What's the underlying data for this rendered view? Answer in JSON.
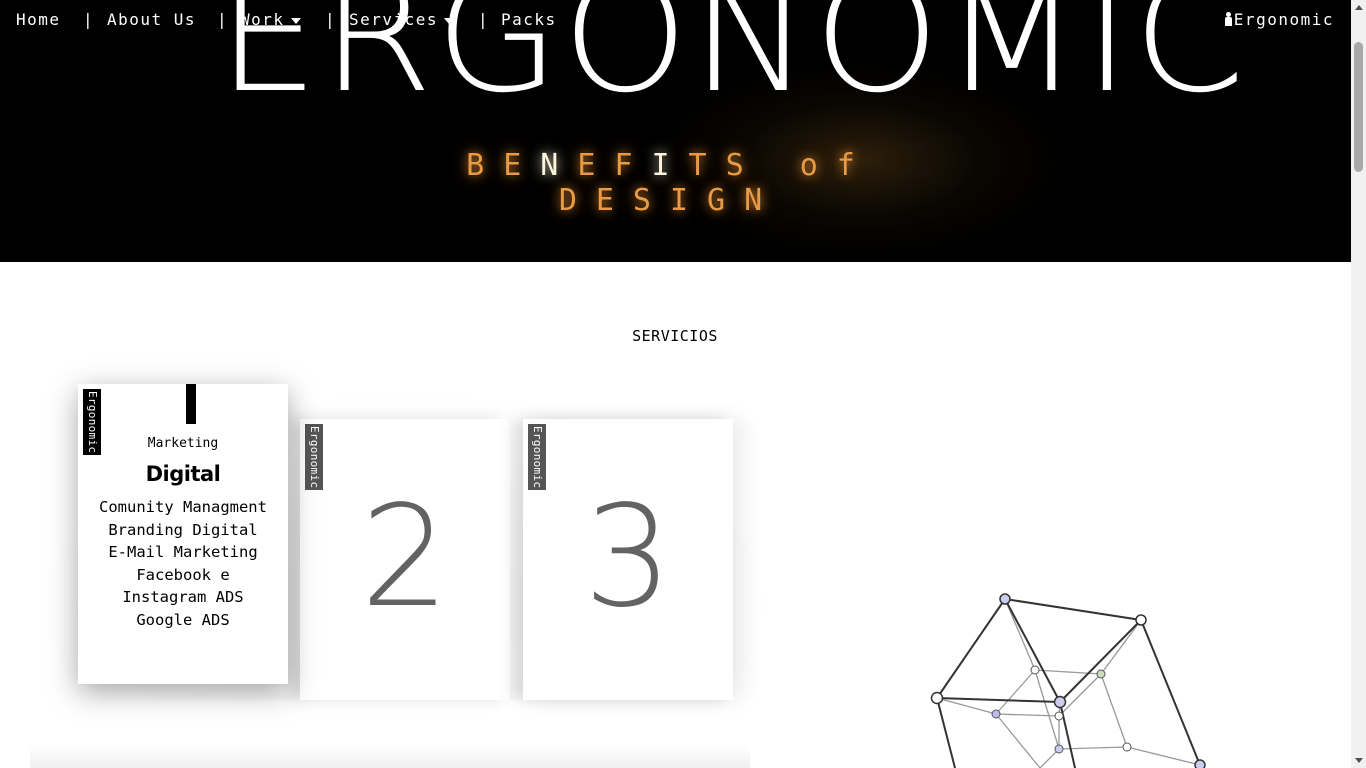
{
  "nav": {
    "items": [
      {
        "label": "Home"
      },
      {
        "label": "About Us"
      },
      {
        "label": "Work"
      },
      {
        "label": "Services"
      },
      {
        "label": "Packs"
      }
    ],
    "separator": "|",
    "brand": "Ergonomic"
  },
  "hero": {
    "title": "ERGONOMIC",
    "subtitle_a": "BE",
    "subtitle_b": "N",
    "subtitle_c": "EF",
    "subtitle_d": "I",
    "subtitle_e": "TS of DESIGN"
  },
  "section": {
    "title": "SERVICIOS"
  },
  "cards": [
    {
      "tab": "Ergonomic",
      "small_label": "Marketing",
      "big_label": "Digital",
      "items": [
        "Comunity Managment",
        "Branding Digital",
        "E-Mail Marketing",
        "Facebook e Instagram ADS",
        "Google ADS"
      ]
    },
    {
      "tab": "Ergonomic",
      "number": "2"
    },
    {
      "tab": "Ergonomic",
      "number": "3"
    }
  ],
  "colors": {
    "hero_bg": "#000000",
    "accent_orange": "#e89a44",
    "card_number": "#636363",
    "tab_dark": "#000000",
    "tab_grey": "#555555"
  },
  "icons": {
    "brand_icon": "person-icon",
    "work_dropdown": "caret-down-icon",
    "services_dropdown": "caret-down-icon"
  }
}
